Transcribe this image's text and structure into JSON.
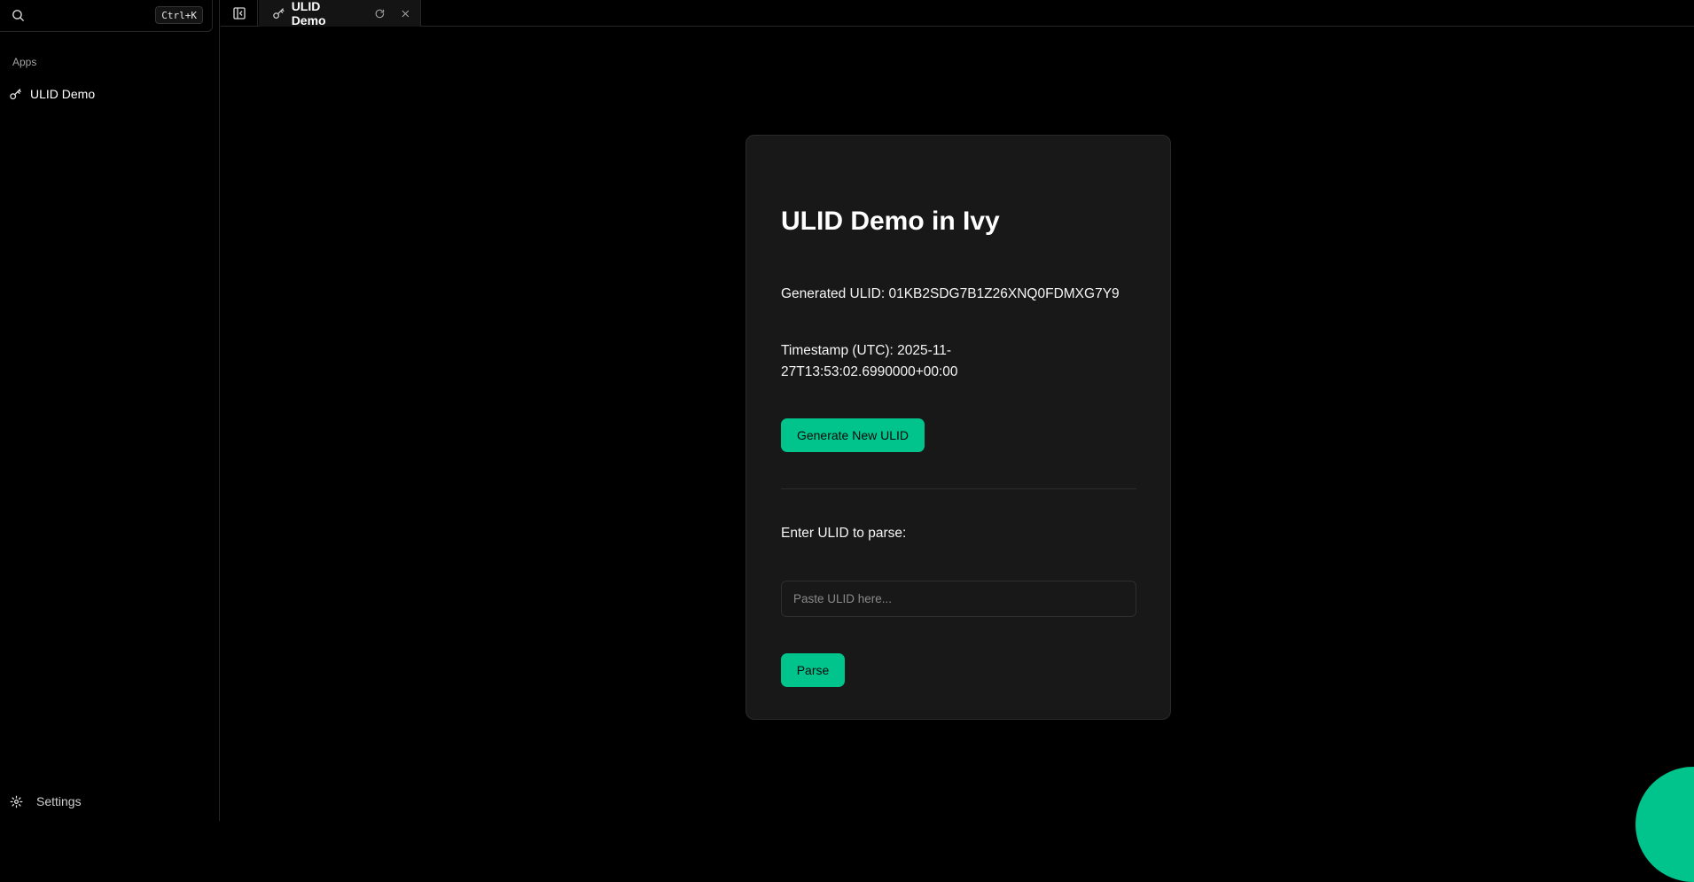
{
  "sidebar": {
    "search_placeholder": "",
    "search_shortcut": "Ctrl+K",
    "section_label": "Apps",
    "items": [
      {
        "label": "ULID Demo",
        "icon": "key-icon"
      }
    ],
    "settings_label": "Settings"
  },
  "tabs": [
    {
      "label": "ULID Demo",
      "icon": "key-icon"
    }
  ],
  "card": {
    "title": "ULID Demo in Ivy",
    "generated_text": "Generated ULID: 01KB2SDG7B1Z26XNQ0FDMXG7Y9",
    "timestamp_text": "Timestamp (UTC): 2025-11-27T13:53:02.6990000+00:00",
    "generate_button": "Generate New ULID",
    "enter_label": "Enter ULID to parse:",
    "input_value": "",
    "input_placeholder": "Paste ULID here...",
    "parse_button": "Parse"
  },
  "colors": {
    "accent": "#00c48c",
    "background": "#000000",
    "card": "#181818"
  }
}
